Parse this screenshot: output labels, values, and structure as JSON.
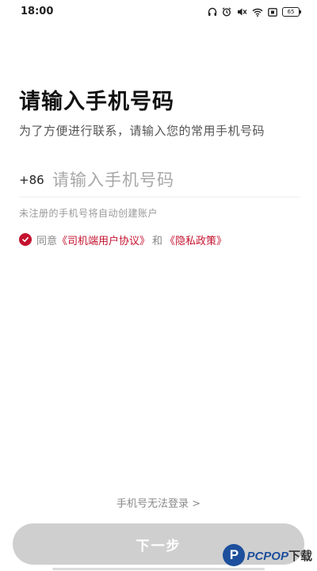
{
  "status_bar": {
    "time": "18:00",
    "battery": "65",
    "icons": [
      "headphones-icon",
      "alarm-icon",
      "mute-icon",
      "wifi-icon",
      "sim-icon",
      "battery-icon"
    ]
  },
  "login": {
    "title": "请输入手机号码",
    "subtitle": "为了方便进行联系，请输入您的常用手机号码",
    "country_code": "+86",
    "phone_placeholder": "请输入手机号码",
    "hint": "未注册的手机号将自动创建账户",
    "agree_prefix": "同意",
    "user_agreement": "《司机端用户协议》",
    "and_text": "和",
    "privacy_policy": "《隐私政策》",
    "agree_checked": true,
    "cant_login": "手机号无法登录 >",
    "next_label": "下一步"
  },
  "watermark": {
    "badge": "P",
    "text": "PCPOP",
    "suffix": "下载"
  },
  "colors": {
    "accent": "#c4122f",
    "button_disabled": "#cfcfcf"
  }
}
